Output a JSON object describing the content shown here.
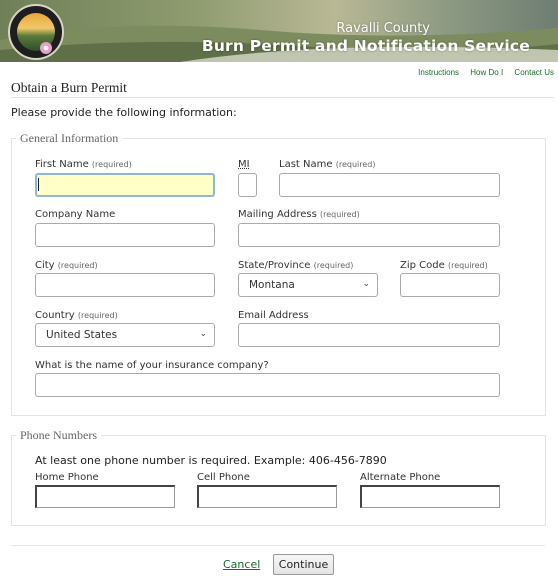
{
  "banner": {
    "county": "Ravalli County",
    "service": "Burn Permit and Notification Service"
  },
  "top_links": [
    "Instructions",
    "How Do I",
    "Contact Us"
  ],
  "page_title": "Obtain a Burn Permit",
  "intro": "Please provide the following information:",
  "general": {
    "legend": "General Information",
    "first_name": "First Name",
    "mi": "MI",
    "last_name": "Last Name",
    "company_name": "Company Name",
    "mailing_address": "Mailing Address",
    "city": "City",
    "state": "State/Province",
    "state_value": "Montana",
    "zip": "Zip Code",
    "country": "Country",
    "country_value": "United States",
    "email": "Email Address",
    "insurance": "What is the name of your insurance company?",
    "required": "(required)"
  },
  "phones": {
    "legend": "Phone Numbers",
    "note": "At least one phone number is required. Example: 406-456-7890",
    "home": "Home Phone",
    "cell": "Cell Phone",
    "alternate": "Alternate Phone"
  },
  "actions": {
    "cancel": "Cancel",
    "continue": "Continue"
  },
  "colors": {
    "link_green": "#1a6b2a",
    "focus_fill": "#ffffc8",
    "focus_border": "#8fb5d8"
  }
}
